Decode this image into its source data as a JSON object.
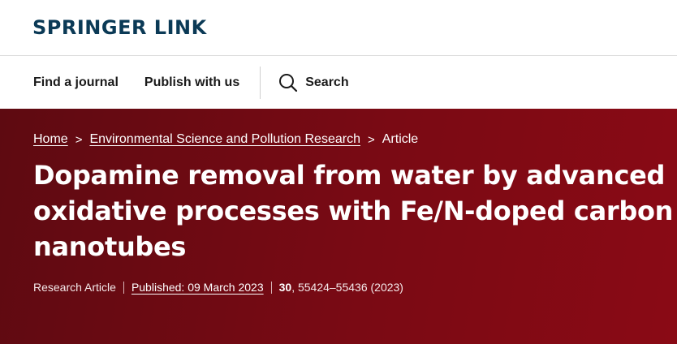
{
  "header": {
    "logo_text": "SPRINGER LINK"
  },
  "nav": {
    "find_journal": "Find a journal",
    "publish": "Publish with us",
    "search_label": "Search",
    "search_icon": "search-icon"
  },
  "breadcrumb": {
    "home": "Home",
    "journal": "Environmental Science and Pollution Research",
    "current": "Article",
    "separator": ">"
  },
  "article": {
    "title": "Dopamine removal from water by advanced oxidative processes with Fe/N-doped carbon nanotubes",
    "type": "Research Article",
    "published": "Published: 09 March 2023",
    "volume": "30",
    "pages": ", 55424–55436 (2023)"
  },
  "colors": {
    "brand_navy": "#0b3a56",
    "hero_red": "#7a0a14"
  }
}
